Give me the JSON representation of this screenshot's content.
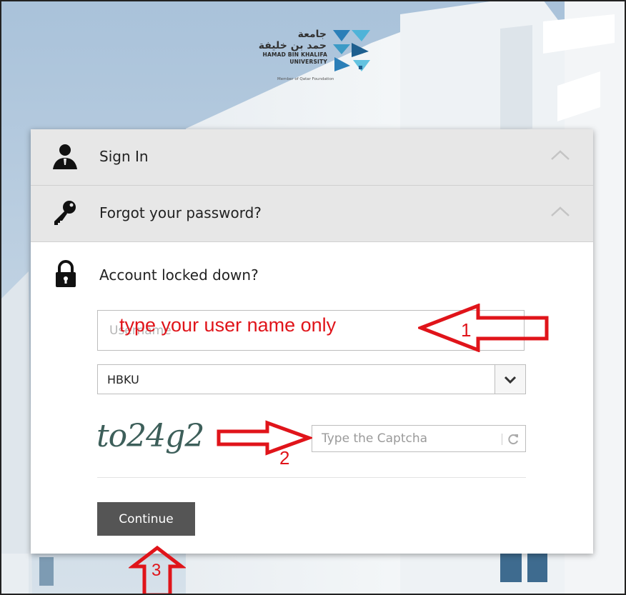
{
  "logo": {
    "arabic_line1": "جامعة",
    "arabic_line2": "حمد بن خليفة",
    "english_line1": "HAMAD BIN KHALIFA",
    "english_line2": "UNIVERSITY",
    "member": "Member of Qatar Foundation"
  },
  "accordion": {
    "sign_in": {
      "label": "Sign In",
      "icon": "user-icon"
    },
    "forgot": {
      "label": "Forgot your password?",
      "icon": "key-icon"
    },
    "locked": {
      "label": "Account locked down?",
      "icon": "lock-icon"
    }
  },
  "form": {
    "username_placeholder": "Username",
    "domain_selected": "HBKU",
    "captcha_text": "to24g2",
    "captcha_placeholder": "Type the Captcha",
    "continue_label": "Continue"
  },
  "annotations": {
    "instruction": "type your user name only",
    "step1": "1",
    "step2": "2",
    "step3": "3",
    "color": "#e0141a"
  }
}
